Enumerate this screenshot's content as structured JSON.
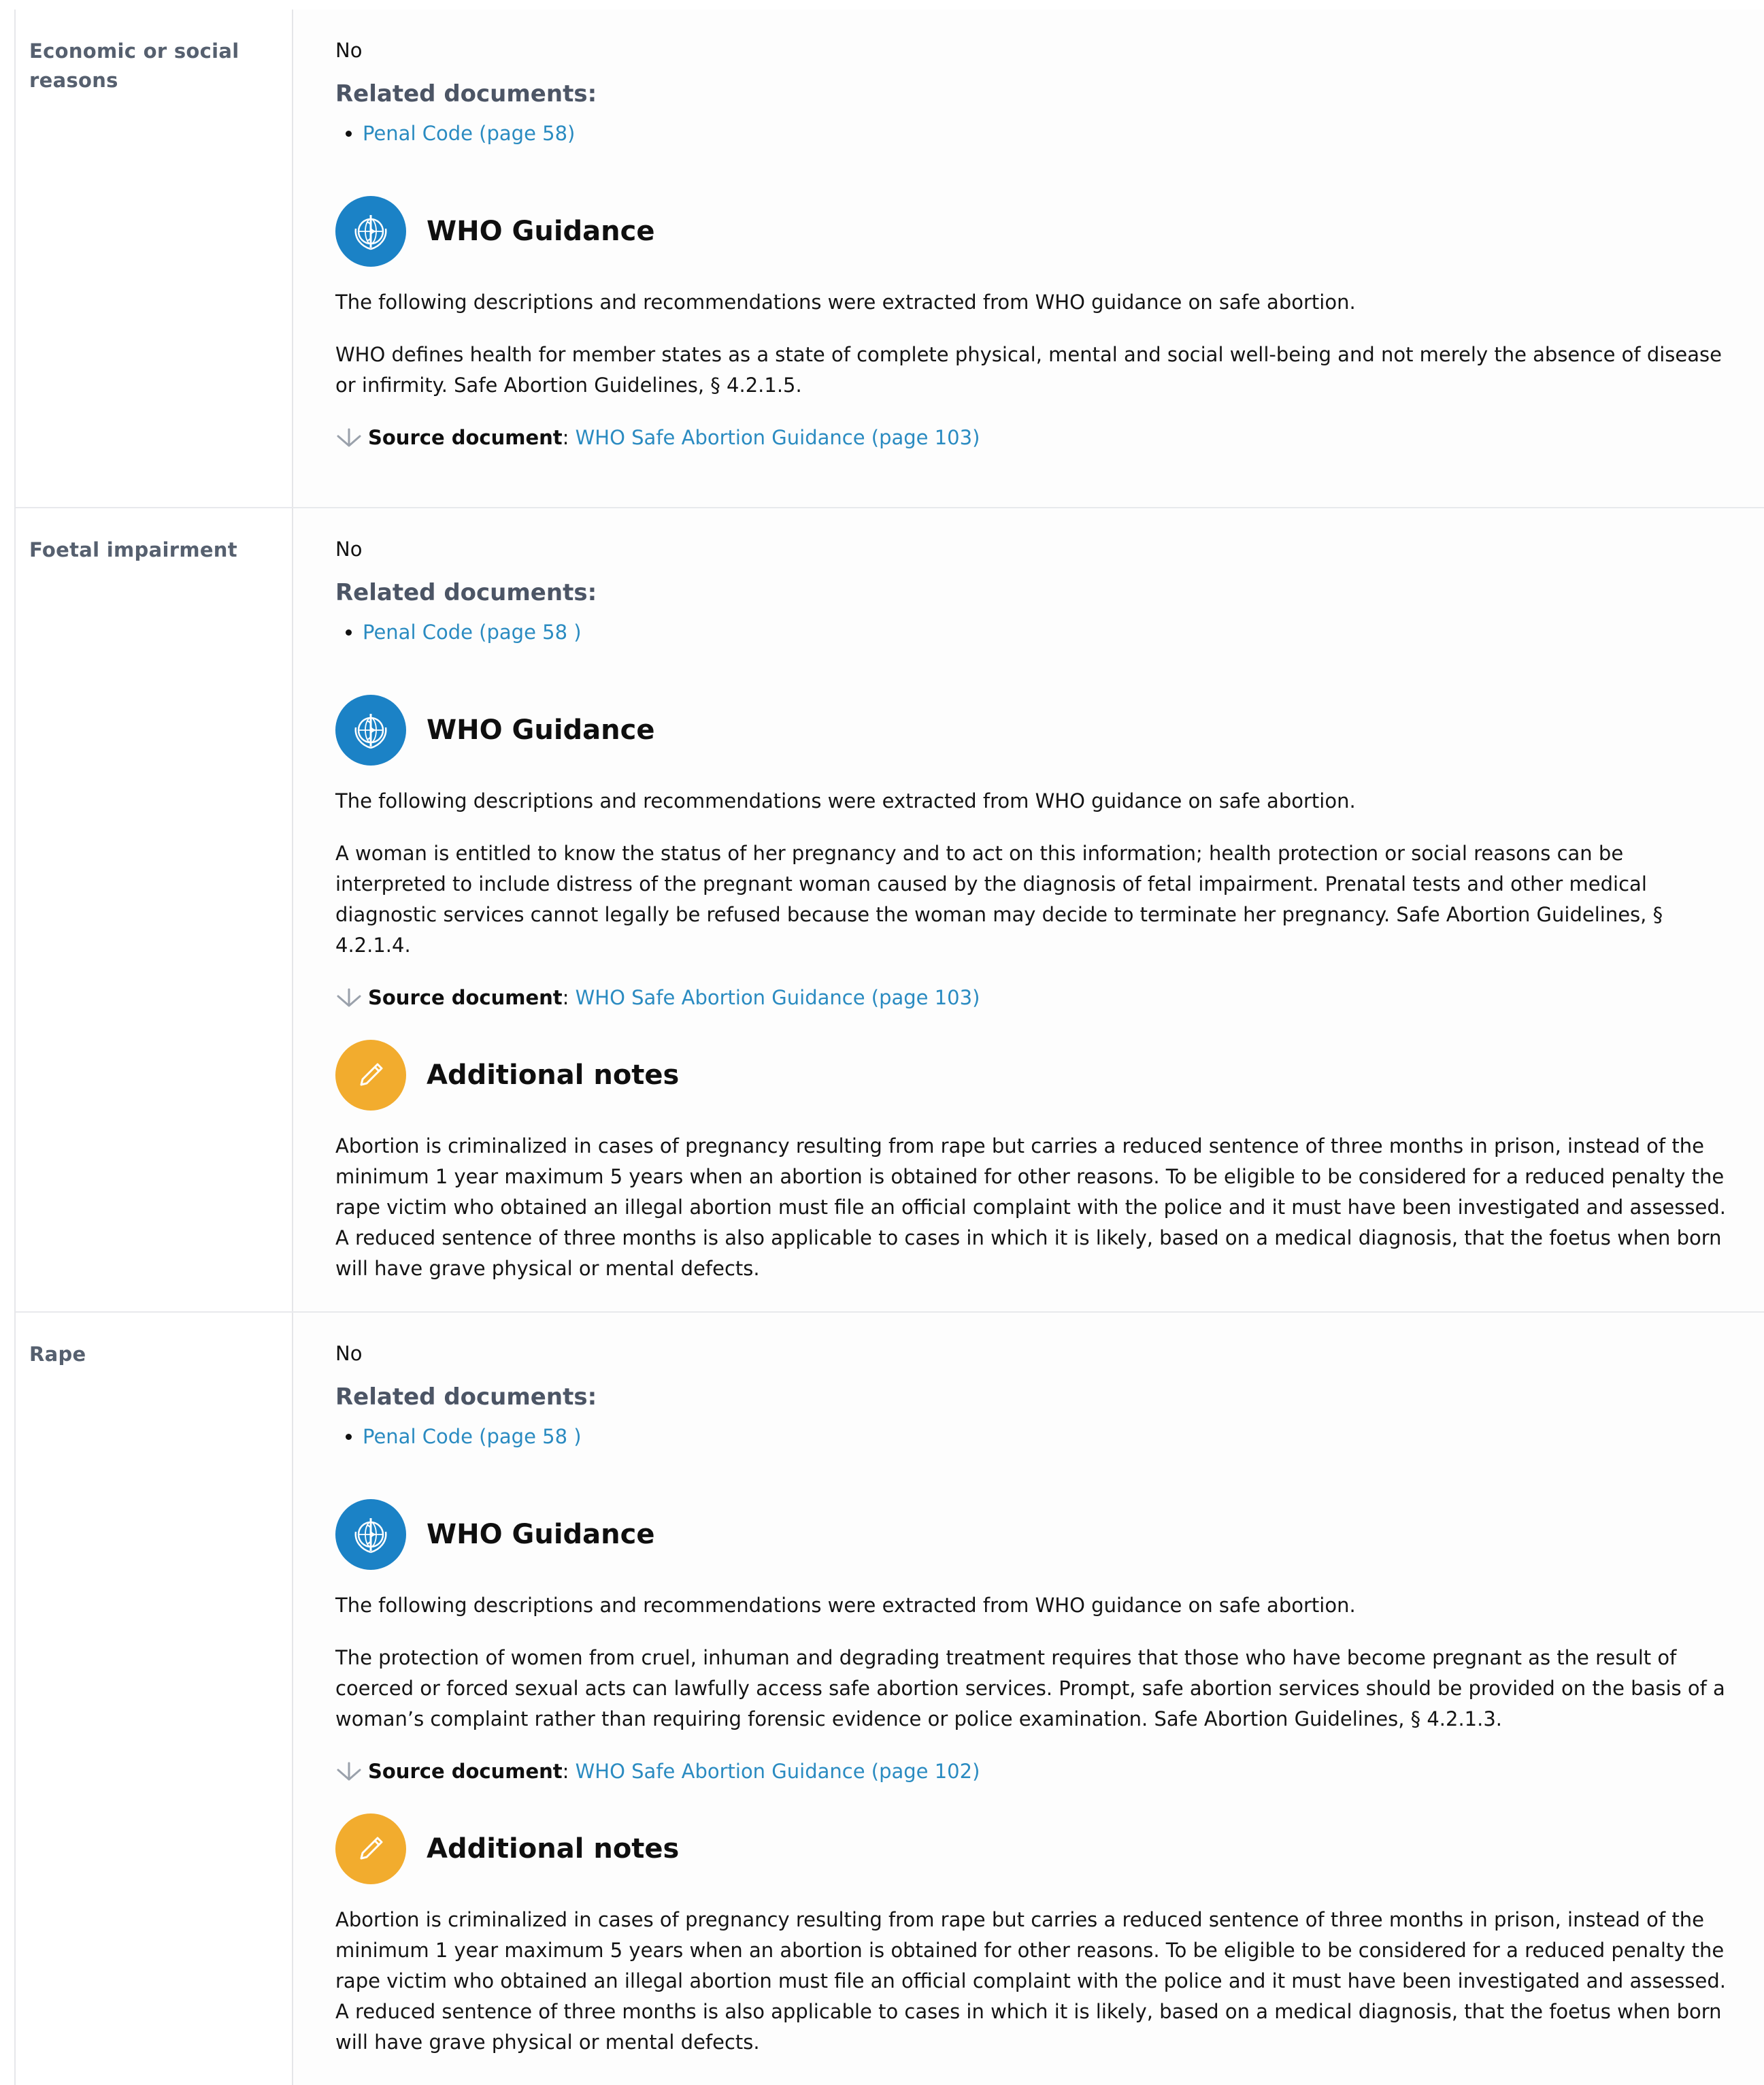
{
  "rows": [
    {
      "label": "Economic or social reasons",
      "answer": "No",
      "related_heading": "Related documents:",
      "documents": [
        "Penal Code (page 58)"
      ],
      "who": {
        "title": "WHO Guidance",
        "intro": "The following descriptions and recommendations were extracted from WHO guidance on safe abortion.",
        "text": "WHO defines health for member states as a state of complete physical, mental and social well-being and not merely the absence of disease or infirmity. Safe Abortion Guidelines, § 4.2.1.5.",
        "source_label": "Source document",
        "source_sep": ":",
        "source_link": "WHO Safe Abortion Guidance (page 103)"
      }
    },
    {
      "label": "Foetal impairment",
      "answer": "No",
      "related_heading": "Related documents:",
      "documents": [
        "Penal Code (page 58 )"
      ],
      "who": {
        "title": "WHO Guidance",
        "intro": "The following descriptions and recommendations were extracted from WHO guidance on safe abortion.",
        "text": "A woman is entitled to know the status of her pregnancy and to act on this information; health protection or social reasons can be interpreted to include distress of the pregnant woman caused by the diagnosis of fetal impairment. Prenatal tests and other medical diagnostic services cannot legally be refused because the woman may decide to terminate her pregnancy. Safe Abortion Guidelines, § 4.2.1.4.",
        "source_label": "Source document",
        "source_sep": ":",
        "source_link": "WHO Safe Abortion Guidance (page 103)"
      },
      "notes": {
        "title": "Additional notes",
        "text": "Abortion is criminalized in cases of pregnancy resulting from rape but carries a reduced sentence of three months in prison, instead of the minimum 1 year maximum 5 years when an abortion is obtained for other reasons. To be eligible to be considered for a reduced penalty the rape victim who obtained an illegal abortion must file an official complaint with the police and it must have been investigated and assessed. A reduced sentence of three months is also applicable to cases in which it is likely, based on a medical diagnosis, that the foetus when born will have grave physical or mental defects."
      }
    },
    {
      "label": "Rape",
      "answer": "No",
      "related_heading": "Related documents:",
      "documents": [
        "Penal Code (page 58 )"
      ],
      "who": {
        "title": "WHO Guidance",
        "intro": "The following descriptions and recommendations were extracted from WHO guidance on safe abortion.",
        "text": "The protection of women from cruel, inhuman and degrading treatment requires that those who have become pregnant as the result of coerced or forced sexual acts can lawfully access safe abortion services. Prompt, safe abortion services should be provided on the basis of a woman’s complaint rather than requiring forensic evidence or police examination. Safe Abortion Guidelines, § 4.2.1.3.",
        "source_label": "Source document",
        "source_sep": ":",
        "source_link": "WHO Safe Abortion Guidance (page 102)"
      },
      "notes": {
        "title": "Additional notes",
        "text": "Abortion is criminalized in cases of pregnancy resulting from rape but carries a reduced sentence of three months in prison, instead of the minimum 1 year maximum 5 years when an abortion is obtained for other reasons. To be eligible to be considered for a reduced penalty the rape victim who obtained an illegal abortion must file an official complaint with the police and it must have been investigated and assessed. A reduced sentence of three months is also applicable to cases in which it is likely, based on a medical diagnosis, that the foetus when born will have grave physical or mental defects."
      }
    }
  ],
  "icons": {
    "who": "who-emblem-icon",
    "notes": "pencil-icon",
    "source": "arrow-down-icon"
  },
  "colors": {
    "link": "#2a8bc1",
    "who_badge": "#1b82c6",
    "notes_badge": "#f2ac2e",
    "label_text": "#56606f"
  }
}
